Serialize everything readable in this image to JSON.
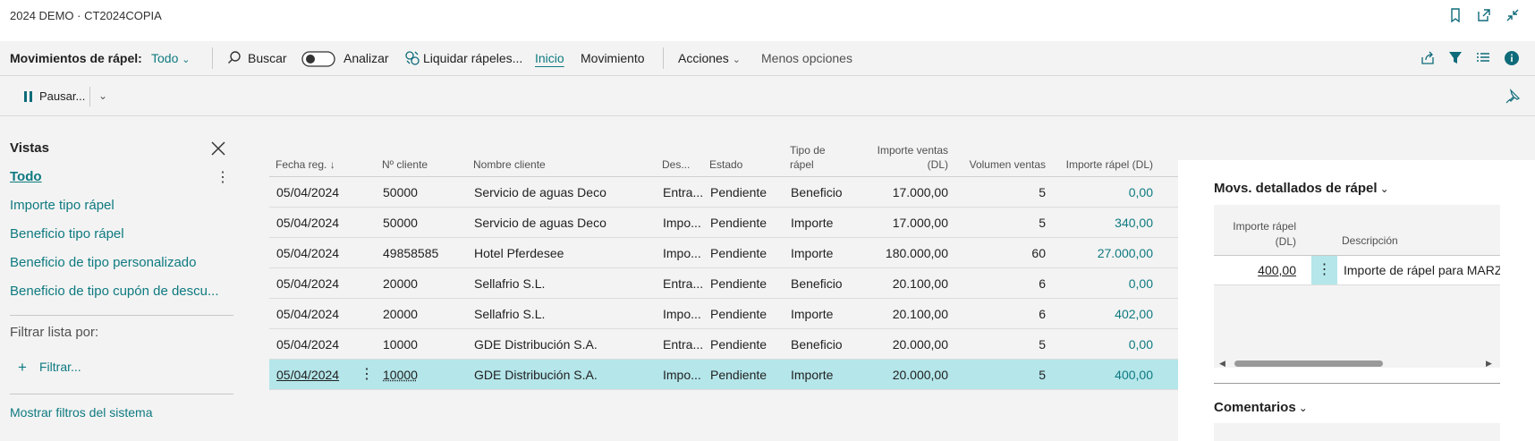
{
  "title": "2024 DEMO · CT2024COPIA",
  "action_bar": {
    "page_caption": "Movimientos de rápel:",
    "view_selector": "Todo",
    "search": "Buscar",
    "analyze": "Analizar",
    "liquidar": "Liquidar rápeles...",
    "inicio": "Inicio",
    "movimiento": "Movimiento",
    "acciones": "Acciones",
    "menos_opciones": "Menos opciones"
  },
  "sub_bar": {
    "pausar": "Pausar..."
  },
  "views": {
    "title": "Vistas",
    "items": [
      "Todo",
      "Importe tipo rápel",
      "Beneficio tipo rápel",
      "Beneficio de tipo personalizado",
      "Beneficio de tipo cupón de descu..."
    ],
    "filter_by": "Filtrar lista por:",
    "filter_add": "Filtrar...",
    "show_system_filters": "Mostrar filtros del sistema"
  },
  "table": {
    "headers": {
      "fecha": "Fecha reg.",
      "cliente": "Nº cliente",
      "nombre": "Nombre cliente",
      "desc": "Des...",
      "estado": "Estado",
      "tipo1": "Tipo de",
      "tipo2": "rápel",
      "importe_ventas1": "Importe ventas",
      "importe_ventas2": "(DL)",
      "volumen": "Volumen ventas",
      "importe_rapel": "Importe rápel (DL)"
    },
    "rows": [
      {
        "fecha": "05/04/2024",
        "cliente": "50000",
        "nombre": "Servicio de aguas Deco",
        "desc": "Entra...",
        "estado": "Pendiente",
        "tipo": "Beneficio",
        "importe_ventas": "17.000,00",
        "volumen": "5",
        "importe_rapel": "0,00"
      },
      {
        "fecha": "05/04/2024",
        "cliente": "50000",
        "nombre": "Servicio de aguas Deco",
        "desc": "Impo...",
        "estado": "Pendiente",
        "tipo": "Importe",
        "importe_ventas": "17.000,00",
        "volumen": "5",
        "importe_rapel": "340,00"
      },
      {
        "fecha": "05/04/2024",
        "cliente": "49858585",
        "nombre": "Hotel Pferdesee",
        "desc": "Impo...",
        "estado": "Pendiente",
        "tipo": "Importe",
        "importe_ventas": "180.000,00",
        "volumen": "60",
        "importe_rapel": "27.000,00"
      },
      {
        "fecha": "05/04/2024",
        "cliente": "20000",
        "nombre": "Sellafrio S.L.",
        "desc": "Entra...",
        "estado": "Pendiente",
        "tipo": "Beneficio",
        "importe_ventas": "20.100,00",
        "volumen": "6",
        "importe_rapel": "0,00"
      },
      {
        "fecha": "05/04/2024",
        "cliente": "20000",
        "nombre": "Sellafrio S.L.",
        "desc": "Impo...",
        "estado": "Pendiente",
        "tipo": "Importe",
        "importe_ventas": "20.100,00",
        "volumen": "6",
        "importe_rapel": "402,00"
      },
      {
        "fecha": "05/04/2024",
        "cliente": "10000",
        "nombre": "GDE Distribución S.A.",
        "desc": "Entra...",
        "estado": "Pendiente",
        "tipo": "Beneficio",
        "importe_ventas": "20.000,00",
        "volumen": "5",
        "importe_rapel": "0,00"
      },
      {
        "fecha": "05/04/2024",
        "cliente": "10000",
        "nombre": "GDE Distribución S.A.",
        "desc": "Impo...",
        "estado": "Pendiente",
        "tipo": "Importe",
        "importe_ventas": "20.000,00",
        "volumen": "5",
        "importe_rapel": "400,00"
      }
    ]
  },
  "factbox": {
    "detail_title": "Movs. detallados de rápel",
    "col_importe1": "Importe rápel",
    "col_importe2": "(DL)",
    "col_desc": "Descripción",
    "row_importe": "400,00",
    "row_desc": "Importe de rápel para MARZ",
    "comments_title": "Comentarios"
  },
  "colors": {
    "accent": "#0e7a80",
    "selected_row": "#b4e6ea"
  }
}
